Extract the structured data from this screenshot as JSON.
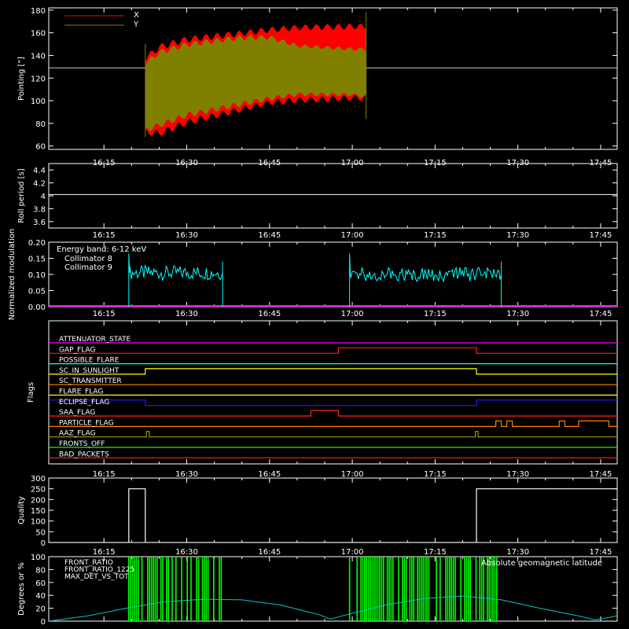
{
  "x_ticks": [
    "16:15",
    "16:30",
    "16:45",
    "17:00",
    "17:15",
    "17:30",
    "17:45"
  ],
  "x_tick_minutes": [
    975,
    990,
    1005,
    1020,
    1035,
    1050,
    1065
  ],
  "x_range_minutes": [
    965,
    1068
  ],
  "chart_data": [
    {
      "type": "area",
      "ylabel": "Pointing [\"]",
      "ylim": [
        57,
        182
      ],
      "yticks": [
        60,
        80,
        100,
        120,
        140,
        160,
        180
      ],
      "reference_line": 129,
      "data_start_minute": 982.5,
      "data_end_minute": 1022.5,
      "series": [
        {
          "name": "X",
          "color": "#ff0000",
          "upper": {
            "x": [
              982.5,
              985,
              990,
              1000,
              1005,
              1010,
              1020,
              1022.5
            ],
            "y": [
              140,
              150,
              157,
              162,
              165,
              167,
              168,
              168
            ]
          },
          "lower": {
            "x": [
              982.5,
              985,
              990,
              1000,
              1005,
              1010,
              1020,
              1022.5
            ],
            "y": [
              70,
              68,
              78,
              90,
              96,
              98,
              100,
              100
            ]
          }
        },
        {
          "name": "Y",
          "color": "#808000",
          "upper": {
            "x": [
              982.5,
              985,
              990,
              1000,
              1005,
              1010,
              1020,
              1022.5
            ],
            "y": [
              135,
              145,
              152,
              158,
              158,
              150,
              147,
              147
            ]
          },
          "lower": {
            "x": [
              982.5,
              985,
              990,
              1000,
              1005,
              1010,
              1020,
              1022.5
            ],
            "y": [
              72,
              76,
              85,
              95,
              100,
              104,
              104,
              102
            ]
          }
        }
      ]
    },
    {
      "type": "line",
      "ylabel": "Roll period [s]",
      "ylim": [
        3.5,
        4.5
      ],
      "yticks": [
        3.6,
        3.8,
        4.0,
        4.2,
        4.4
      ],
      "series": [
        {
          "name": "",
          "color": "#ffffff",
          "x": [
            965,
            1068
          ],
          "y": [
            4.02,
            4.02
          ]
        }
      ]
    },
    {
      "type": "line",
      "ylabel": "Normalized modulation",
      "ylim": [
        0,
        0.2
      ],
      "yticks": [
        "0.00",
        "0.05",
        "0.10",
        "0.15",
        "0.20"
      ],
      "annotation": "Energy band: 6-12 keV",
      "series": [
        {
          "name": "Collimator 8",
          "color": "#00ffff",
          "segments": [
            {
              "start": 979.5,
              "end": 996.5,
              "level": 0.105
            },
            {
              "start": 1019.5,
              "end": 1047,
              "level": 0.1
            }
          ]
        },
        {
          "name": "Collimator 9",
          "color": "#ff00ff",
          "x": [
            965,
            1068
          ],
          "y": [
            0,
            0
          ]
        }
      ]
    },
    {
      "type": "line",
      "ylabel": "Flags",
      "flags": [
        {
          "name": "ATTENUATOR_STATE",
          "color": "#ff00ff",
          "x": [
            965,
            1068
          ],
          "v": [
            0,
            0
          ]
        },
        {
          "name": "GAP_FLAG",
          "color": "#ff2020",
          "x": [
            965,
            1017.5,
            1017.5,
            1042.5,
            1042.5,
            1068
          ],
          "v": [
            0,
            0,
            1,
            1,
            0,
            0
          ]
        },
        {
          "name": "POSSIBLE_FLARE",
          "color": "#00ffff",
          "x": [
            965,
            1068
          ],
          "v": [
            0,
            0
          ]
        },
        {
          "name": "SC_IN_SUNLIGHT",
          "color": "#ffff00",
          "x": [
            965,
            982.5,
            982.5,
            1042.5,
            1042.5,
            1068
          ],
          "v": [
            0,
            0,
            1,
            1,
            0,
            0
          ]
        },
        {
          "name": "SC_TRANSMITTER",
          "color": "#ff8000",
          "x": [
            965,
            1068
          ],
          "v": [
            0,
            0
          ]
        },
        {
          "name": "FLARE_FLAG",
          "color": "#ffff40",
          "x": [
            965,
            1068
          ],
          "v": [
            0,
            0
          ]
        },
        {
          "name": "ECLIPSE_FLAG",
          "color": "#2020ff",
          "x": [
            965,
            982.5,
            982.5,
            1042.5,
            1042.5,
            1068
          ],
          "v": [
            1,
            1,
            0,
            0,
            1,
            1
          ]
        },
        {
          "name": "SAA_FLAG",
          "color": "#ff2020",
          "x": [
            965,
            1012.5,
            1012.5,
            1017.5,
            1017.5,
            1068
          ],
          "v": [
            0,
            0,
            1,
            1,
            0,
            0
          ]
        },
        {
          "name": "PARTICLE_FLAG",
          "color": "#ff8000",
          "x": [
            965,
            1046,
            1046,
            1047,
            1047,
            1048,
            1048,
            1049,
            1049,
            1057.5,
            1057.5,
            1058.5,
            1058.5,
            1061,
            1061,
            1066.5,
            1066.5,
            1068
          ],
          "v": [
            0,
            0,
            1,
            1,
            0,
            0,
            1,
            1,
            0,
            0,
            1,
            1,
            0,
            0,
            1,
            1,
            0,
            0
          ]
        },
        {
          "name": "AAZ_FLAG",
          "color": "#a0a000",
          "x": [
            965,
            982.7,
            982.7,
            983.2,
            983.2,
            1042.3,
            1042.3,
            1042.8,
            1042.8,
            1068
          ],
          "v": [
            0,
            0,
            1,
            1,
            0,
            0,
            1,
            1,
            0,
            0
          ]
        },
        {
          "name": "FRONTS_OFF",
          "color": "#00ff00",
          "x": [
            965,
            1068
          ],
          "v": [
            0,
            0
          ]
        },
        {
          "name": "BAD_PACKETS",
          "color": "#ff2020",
          "x": [
            965,
            1068
          ],
          "v": [
            0,
            0
          ]
        }
      ]
    },
    {
      "type": "line",
      "ylabel": "Quality",
      "ylim": [
        0,
        300
      ],
      "yticks": [
        0,
        50,
        100,
        150,
        200,
        250,
        300
      ],
      "series": [
        {
          "name": "",
          "color": "#ffffff",
          "x": [
            965,
            979.5,
            979.5,
            982.5,
            982.5,
            1042.5,
            1042.5,
            1068
          ],
          "y": [
            0,
            0,
            250,
            250,
            0,
            0,
            250,
            250
          ]
        }
      ]
    },
    {
      "type": "line",
      "ylabel": "Degrees or %",
      "ylim": [
        0,
        100
      ],
      "yticks": [
        0,
        20,
        40,
        60,
        80,
        100
      ],
      "annotation_right": "Absolute geomagnetic latitude",
      "legend": [
        {
          "name": "FRONT_RATIO",
          "color": "#ffff00"
        },
        {
          "name": "FRONT_RATIO_1225",
          "color": "#00ff00"
        },
        {
          "name": "MAX_DET_VS_TOT",
          "color": "#ff8000"
        }
      ],
      "latitude": {
        "name": "Absolute geomagnetic latitude",
        "color": "#00c8c8",
        "x": [
          965,
          972,
          979,
          986,
          993,
          1000,
          1007,
          1014,
          1016,
          1019,
          1026,
          1033,
          1040,
          1047,
          1054,
          1061,
          1064,
          1068
        ],
        "y": [
          0,
          8,
          20,
          30,
          34,
          33,
          25,
          10,
          3,
          10,
          25,
          35,
          39,
          33,
          20,
          8,
          2,
          8
        ]
      },
      "fill_bars": [
        {
          "start": 979.5,
          "end": 996.5,
          "color": "#00ff00"
        },
        {
          "start": 1019.5,
          "end": 1047,
          "color": "#00ff00"
        }
      ]
    }
  ]
}
